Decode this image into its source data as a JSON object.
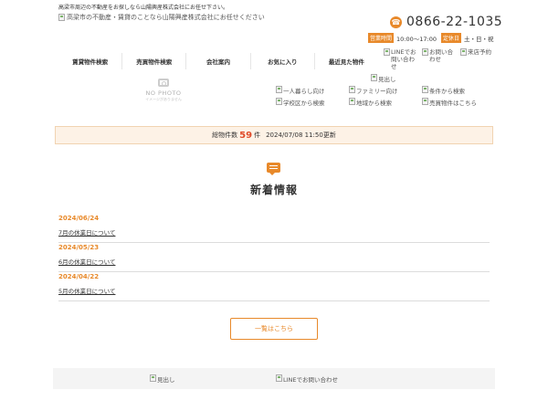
{
  "header": {
    "tagline": "高梁市周辺の不動産をお探しなら山陽興産株式会社にお任せ下さい。",
    "logo_alt": "高梁市の不動産・賃貸のことなら山陽興産株式会社にお任せください",
    "phone": "0866-22-1035",
    "hours_label": "営業時間",
    "hours_value": "10:00～17:00",
    "closed_label": "定休日",
    "closed_value": "土・日・祝"
  },
  "nav": {
    "items": [
      "賃貸物件検索",
      "売買物件検索",
      "会社案内",
      "お気に入り",
      "最近見た物件"
    ]
  },
  "sub_links": {
    "line": "LINEでお問い合わせ",
    "contact": "お問い合わせ",
    "visit": "来店予約"
  },
  "banner": {
    "no_photo_title": "NO PHOTO",
    "no_photo_sub": "イメージがありません",
    "midashi": "見出し"
  },
  "search_links": [
    "一人暮らし向け",
    "ファミリー向け",
    "条件から検索",
    "学校区から検索",
    "地域から検索",
    "売買物件はこちら"
  ],
  "property_count": {
    "label": "総物件数",
    "count": "59",
    "unit": "件",
    "updated": "2024/07/08 11:50更新"
  },
  "news": {
    "heading": "新着情報",
    "items": [
      {
        "date": "2024/06/24",
        "title": "7月の休業日について"
      },
      {
        "date": "2024/05/23",
        "title": "6月の休業日について"
      },
      {
        "date": "2024/04/22",
        "title": "5月の休業日について"
      }
    ],
    "more_label": "一覧はこちら"
  },
  "footer": {
    "midashi": "見出し",
    "line_contact": "LINEでお問い合わせ"
  },
  "colors": {
    "accent": "#e8892a",
    "count_highlight": "#e04b2a",
    "count_bar_bg": "#fdf2e6"
  },
  "icons": {
    "phone": "phone-icon",
    "news": "speech-bubble-icon",
    "photo": "camera-icon",
    "broken_image": "broken-image-icon"
  }
}
